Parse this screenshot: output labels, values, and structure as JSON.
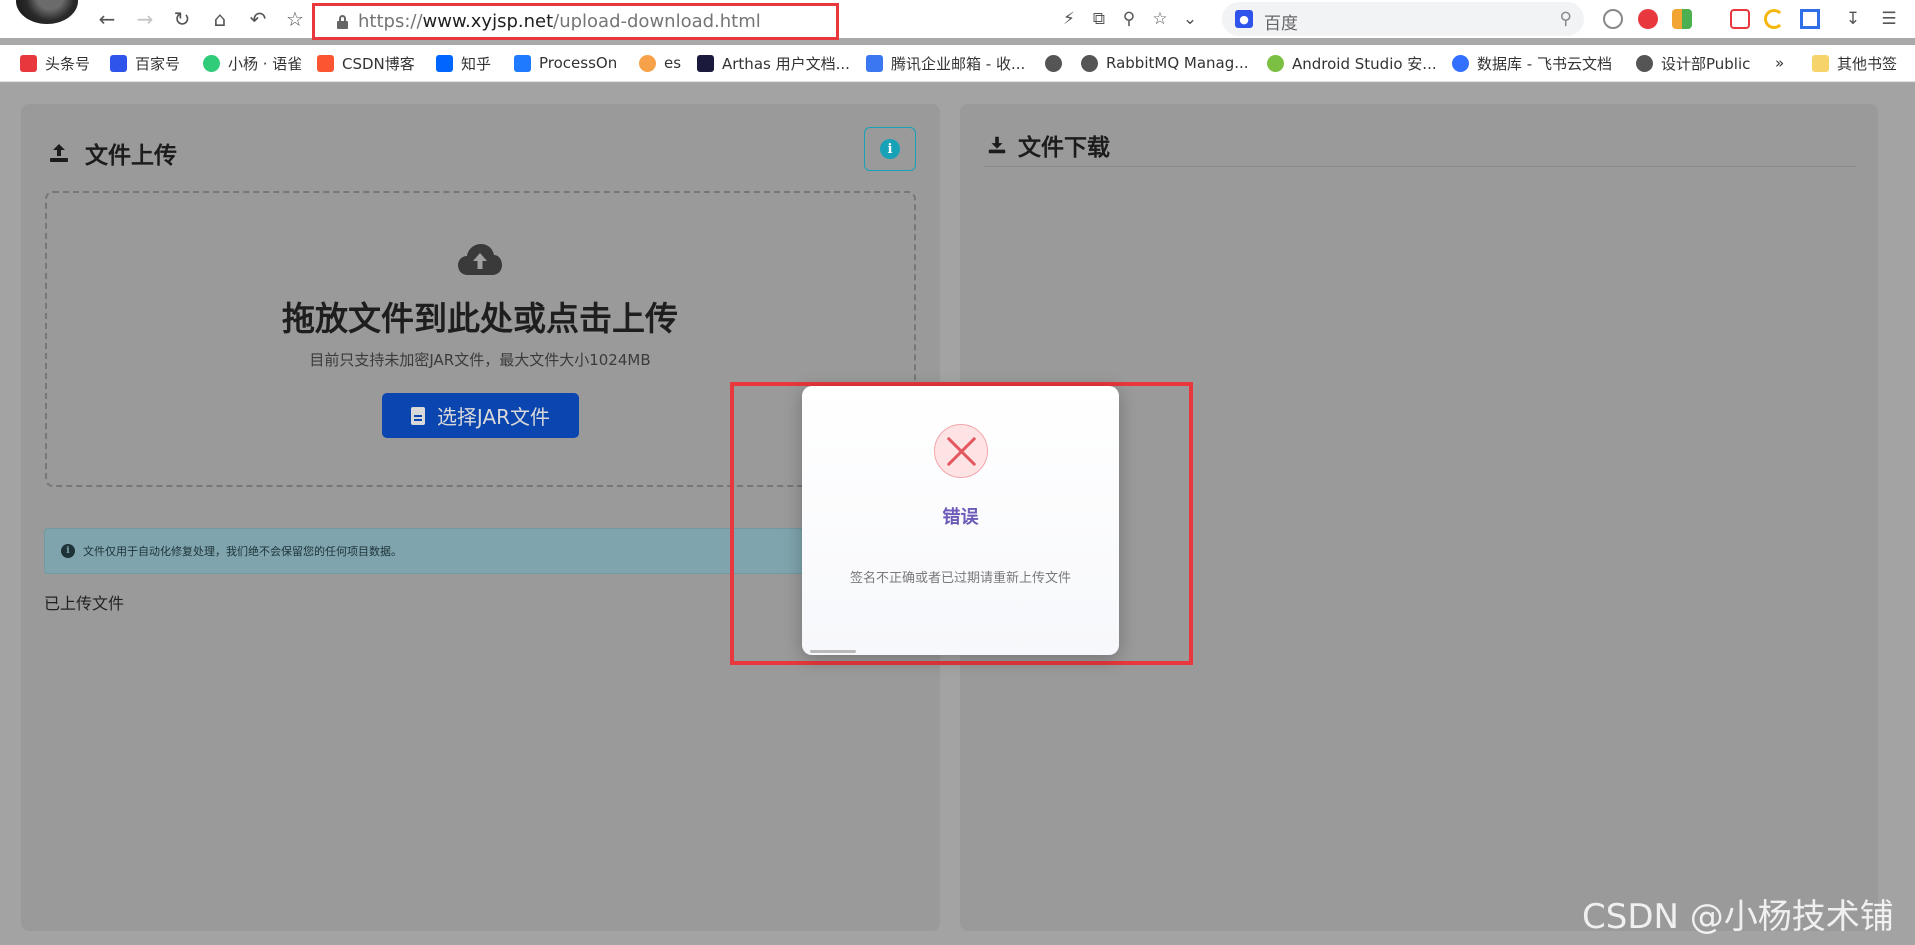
{
  "browser": {
    "address_scheme": "https://",
    "address_host": "www.xyjsp.net",
    "address_path": "/upload-download.html",
    "search_placeholder": "百度",
    "bookmarks": [
      {
        "label": "头条号",
        "color": "#e8383d",
        "icon": "toutiao-icon"
      },
      {
        "label": "百家号",
        "color": "#2f54eb",
        "icon": "baijiahao-icon"
      },
      {
        "label": "小杨 · 语雀",
        "color": "#31cc79",
        "icon": "yuque-icon"
      },
      {
        "label": "CSDN博客",
        "color": "#fc5531",
        "icon": "csdn-icon"
      },
      {
        "label": "知乎",
        "color": "#0066ff",
        "icon": "zhihu-icon"
      },
      {
        "label": "ProcessOn",
        "color": "#1f7aff",
        "icon": "processon-icon"
      },
      {
        "label": "es",
        "color": "#f7a24b",
        "icon": "es-icon"
      },
      {
        "label": "Arthas 用户文档...",
        "color": "#1b1a3d",
        "icon": "arthas-icon"
      },
      {
        "label": "腾讯企业邮箱 - 收...",
        "color": "#3a78f2",
        "icon": "tencent-mail-icon"
      },
      {
        "label": "",
        "color": "#555555",
        "icon": "globe-icon"
      },
      {
        "label": "RabbitMQ Manag...",
        "color": "#555555",
        "icon": "globe-icon"
      },
      {
        "label": "Android Studio 安...",
        "color": "#7bc043",
        "icon": "android-icon"
      },
      {
        "label": "数据库 - 飞书云文档",
        "color": "#3370ff",
        "icon": "feishu-icon"
      },
      {
        "label": "设计部Public",
        "color": "#555555",
        "icon": "globe-icon"
      },
      {
        "label": "其他书签",
        "color": "#f7d36b",
        "icon": "folder-icon"
      }
    ],
    "more_bookmarks": "»"
  },
  "upload": {
    "title": "文件上传",
    "drop_title": "拖放文件到此处或点击上传",
    "drop_hint": "目前只支持未加密JAR文件，最大文件大小1024MB",
    "choose_button": "选择JAR文件",
    "notice": "文件仅用于自动化修复处理，我们绝不会保留您的任何项目数据。",
    "uploaded_label": "已上传文件",
    "info_icon": "i"
  },
  "download": {
    "title": "文件下载"
  },
  "modal": {
    "title": "错误",
    "message": "签名不正确或者已过期请重新上传文件",
    "status_color": "#e35860"
  },
  "watermark": "CSDN @小杨技术铺"
}
